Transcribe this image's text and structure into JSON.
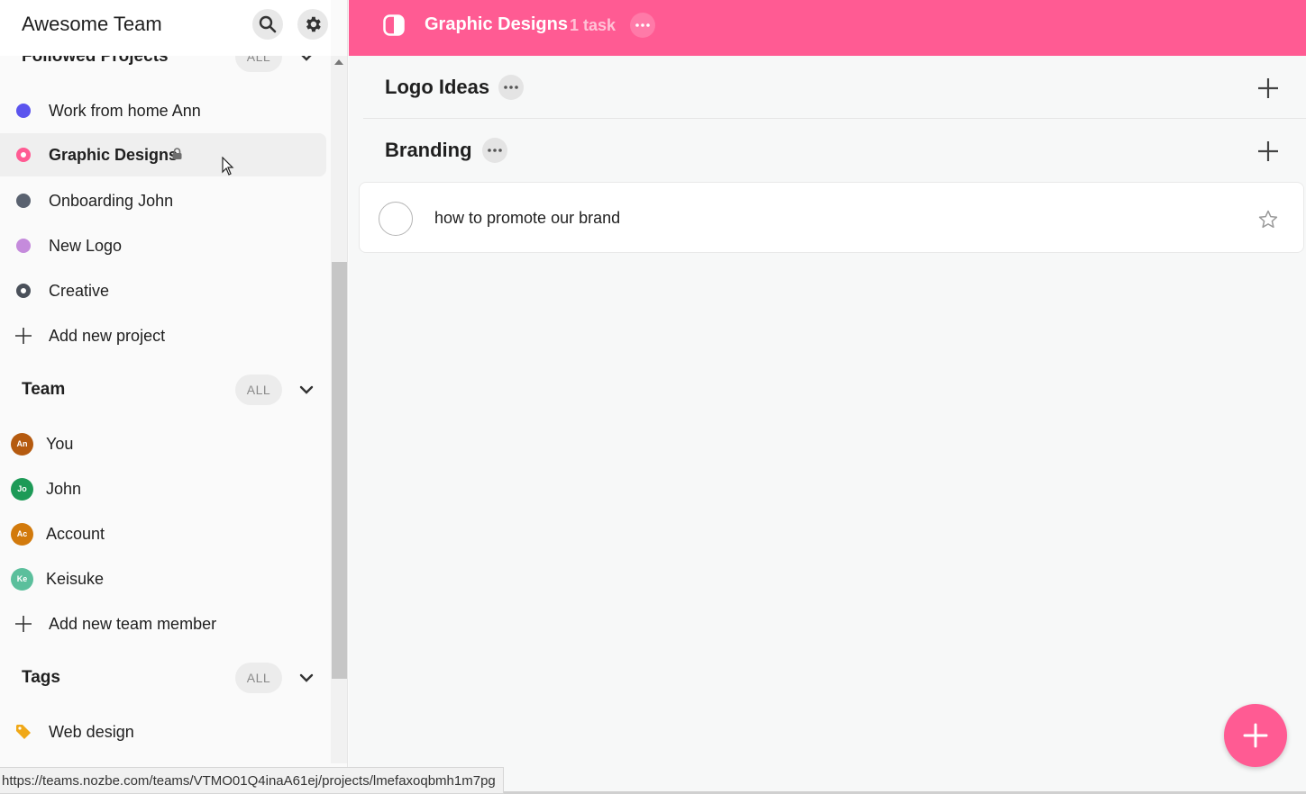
{
  "sidebar": {
    "team_name": "Awesome Team",
    "followed": {
      "title": "Followed Projects",
      "all_label": "ALL",
      "projects": [
        {
          "label": "Work from home Ann",
          "color": "#5b54ee",
          "style": "solid"
        },
        {
          "label": "Graphic Designs",
          "color": "#ff5b93",
          "style": "ring",
          "active": true,
          "locked": true
        },
        {
          "label": "Onboarding John",
          "color": "#5a6270",
          "style": "solid"
        },
        {
          "label": "New Logo",
          "color": "#c58bdc",
          "style": "solid"
        },
        {
          "label": "Creative",
          "color": "#4a505a",
          "style": "ring"
        }
      ],
      "add_label": "Add new project"
    },
    "team": {
      "title": "Team",
      "all_label": "ALL",
      "members": [
        {
          "initials": "An",
          "label": "You",
          "color": "#b55a0f"
        },
        {
          "initials": "Jo",
          "label": "John",
          "color": "#1d9a57"
        },
        {
          "initials": "Ac",
          "label": "Account",
          "color": "#d27a0c"
        },
        {
          "initials": "Ke",
          "label": "Keisuke",
          "color": "#5bbf9c"
        }
      ],
      "add_label": "Add new team member"
    },
    "tags": {
      "title": "Tags",
      "all_label": "ALL",
      "items": [
        {
          "label": "Web design",
          "color": "#f0a818"
        }
      ]
    }
  },
  "topbar": {
    "project_title": "Graphic Designs",
    "task_count": "1 task",
    "color": "#ff5b93"
  },
  "sections": [
    {
      "name": "Logo Ideas"
    },
    {
      "name": "Branding"
    }
  ],
  "tasks": [
    {
      "text": "how to promote our brand"
    }
  ],
  "status_url": "https://teams.nozbe.com/teams/VTMO01Q4inaA61ej/projects/lmefaxoqbmh1m7pg"
}
